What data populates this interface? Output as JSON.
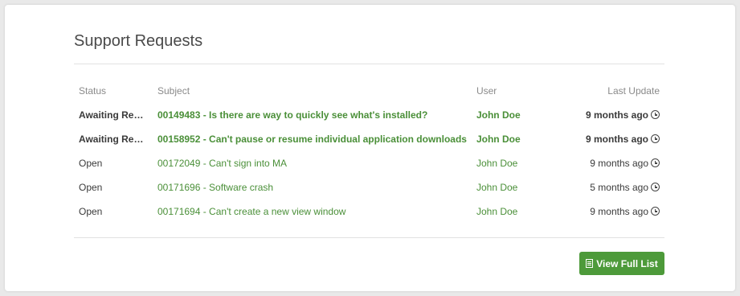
{
  "panel": {
    "title": "Support Requests"
  },
  "table": {
    "headers": {
      "status": "Status",
      "subject": "Subject",
      "user": "User",
      "last_update": "Last Update"
    },
    "rows": [
      {
        "status": "Awaiting Respo...",
        "subject": "00149483 - Is there are way to quickly see what's installed?",
        "user": "John Doe",
        "last_update": "9 months ago",
        "bold": true
      },
      {
        "status": "Awaiting Respo...",
        "subject": "00158952 - Can't pause or resume individual application downloads",
        "user": "John Doe",
        "last_update": "9 months ago",
        "bold": true
      },
      {
        "status": "Open",
        "subject": "00172049 - Can't sign into MA",
        "user": "John Doe",
        "last_update": "9 months ago",
        "bold": false
      },
      {
        "status": "Open",
        "subject": "00171696 - Software crash",
        "user": "John Doe",
        "last_update": "5 months ago",
        "bold": false
      },
      {
        "status": "Open",
        "subject": "00171694 - Can't create a new view window",
        "user": "John Doe",
        "last_update": "9 months ago",
        "bold": false
      }
    ]
  },
  "actions": {
    "view_full_list_label": "View Full List",
    "view_full_list_icon": "list-icon"
  },
  "colors": {
    "accent_green": "#4d9a3a",
    "link_green": "#4a8f38"
  }
}
